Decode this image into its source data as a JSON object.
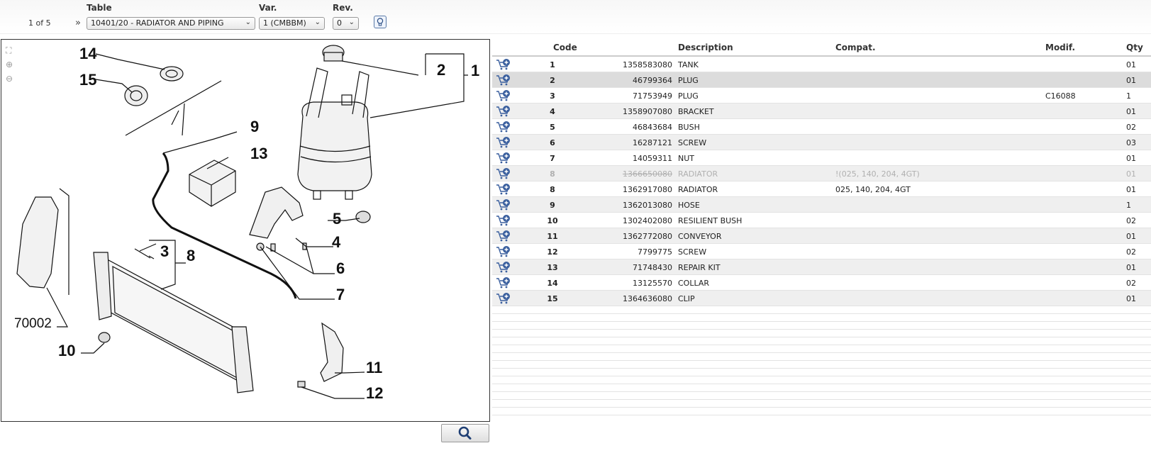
{
  "toolbar": {
    "pager": "1 of 5",
    "table_label": "Table",
    "table_value": "10401/20 - RADIATOR AND PIPING",
    "var_label": "Var.",
    "var_value": "1 (CMBBM)",
    "rev_label": "Rev.",
    "rev_value": "0"
  },
  "drawing": {
    "callouts": [
      "14",
      "15",
      "2",
      "1",
      "9",
      "13",
      "5",
      "4",
      "3",
      "8",
      "6",
      "7",
      "70002",
      "10",
      "11",
      "12"
    ]
  },
  "table": {
    "headers": {
      "code": "Code",
      "description": "Description",
      "compat": "Compat.",
      "modif": "Modif.",
      "qty": "Qty"
    },
    "rows": [
      {
        "pos": "1",
        "code": "1358583080",
        "description": "TANK",
        "compat": "",
        "modif": "",
        "qty": "01"
      },
      {
        "pos": "2",
        "code": "46799364",
        "description": "PLUG",
        "compat": "",
        "modif": "",
        "qty": "01"
      },
      {
        "pos": "3",
        "code": "71753949",
        "description": "PLUG",
        "compat": "",
        "modif": "C16088",
        "qty": "1"
      },
      {
        "pos": "4",
        "code": "1358907080",
        "description": "BRACKET",
        "compat": "",
        "modif": "",
        "qty": "01"
      },
      {
        "pos": "5",
        "code": "46843684",
        "description": "BUSH",
        "compat": "",
        "modif": "",
        "qty": "02"
      },
      {
        "pos": "6",
        "code": "16287121",
        "description": "SCREW",
        "compat": "",
        "modif": "",
        "qty": "03"
      },
      {
        "pos": "7",
        "code": "14059311",
        "description": "NUT",
        "compat": "",
        "modif": "",
        "qty": "01"
      },
      {
        "pos": "8",
        "code": "1366650080",
        "description": "RADIATOR",
        "compat": "!(025, 140, 204, 4GT)",
        "modif": "",
        "qty": "01"
      },
      {
        "pos": "8",
        "code": "1362917080",
        "description": "RADIATOR",
        "compat": "025, 140, 204, 4GT",
        "modif": "",
        "qty": "01"
      },
      {
        "pos": "9",
        "code": "1362013080",
        "description": "HOSE",
        "compat": "",
        "modif": "",
        "qty": "1"
      },
      {
        "pos": "10",
        "code": "1302402080",
        "description": "RESILIENT BUSH",
        "compat": "",
        "modif": "",
        "qty": "02"
      },
      {
        "pos": "11",
        "code": "1362772080",
        "description": "CONVEYOR",
        "compat": "",
        "modif": "",
        "qty": "01"
      },
      {
        "pos": "12",
        "code": "7799775",
        "description": "SCREW",
        "compat": "",
        "modif": "",
        "qty": "02"
      },
      {
        "pos": "13",
        "code": "71748430",
        "description": "REPAIR KIT",
        "compat": "",
        "modif": "",
        "qty": "01"
      },
      {
        "pos": "14",
        "code": "13125570",
        "description": "COLLAR",
        "compat": "",
        "modif": "",
        "qty": "02"
      },
      {
        "pos": "15",
        "code": "1364636080",
        "description": "CLIP",
        "compat": "",
        "modif": "",
        "qty": "01"
      }
    ]
  },
  "colors": {
    "cart_icon": "#3a5f9e",
    "selected_row": "#dcdcdc",
    "alt_row": "#efefef",
    "struck_text": "#b0b0b0"
  }
}
